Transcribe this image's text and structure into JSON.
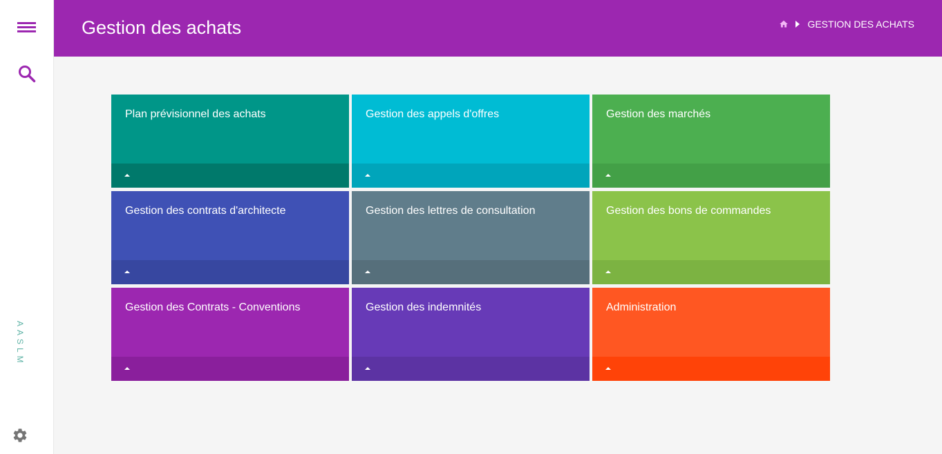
{
  "sidebar": {
    "menu_icon": "menu-icon",
    "search_icon": "search-icon",
    "brand": "AASLM",
    "settings_icon": "gear-icon"
  },
  "header": {
    "title": "Gestion des achats",
    "breadcrumb": {
      "home_icon": "home-icon",
      "current": "GESTION DES ACHATS"
    }
  },
  "colors": {
    "header": "#9c27b0",
    "background": "#f5f5f5"
  },
  "tiles": [
    {
      "title": "Plan prévisionnel des achats",
      "color": "#009688",
      "footer_color": "#00796b"
    },
    {
      "title": "Gestion des appels d'offres",
      "color": "#00bcd4",
      "footer_color": "#00a5bb"
    },
    {
      "title": "Gestion des marchés",
      "color": "#4caf50",
      "footer_color": "#43a047"
    },
    {
      "title": "Gestion des contrats d'architecte",
      "color": "#3f51b5",
      "footer_color": "#3747a0"
    },
    {
      "title": "Gestion des lettres de consultation",
      "color": "#607d8b",
      "footer_color": "#566f7b"
    },
    {
      "title": "Gestion des bons de commandes",
      "color": "#8bc34a",
      "footer_color": "#7cb342"
    },
    {
      "title": "Gestion des Contrats - Conventions",
      "color": "#9c27b0",
      "footer_color": "#8a1f9c"
    },
    {
      "title": "Gestion des indemnités",
      "color": "#673ab7",
      "footer_color": "#5c33a3"
    },
    {
      "title": "Administration",
      "color": "#ff5722",
      "footer_color": "#ff4308"
    }
  ]
}
